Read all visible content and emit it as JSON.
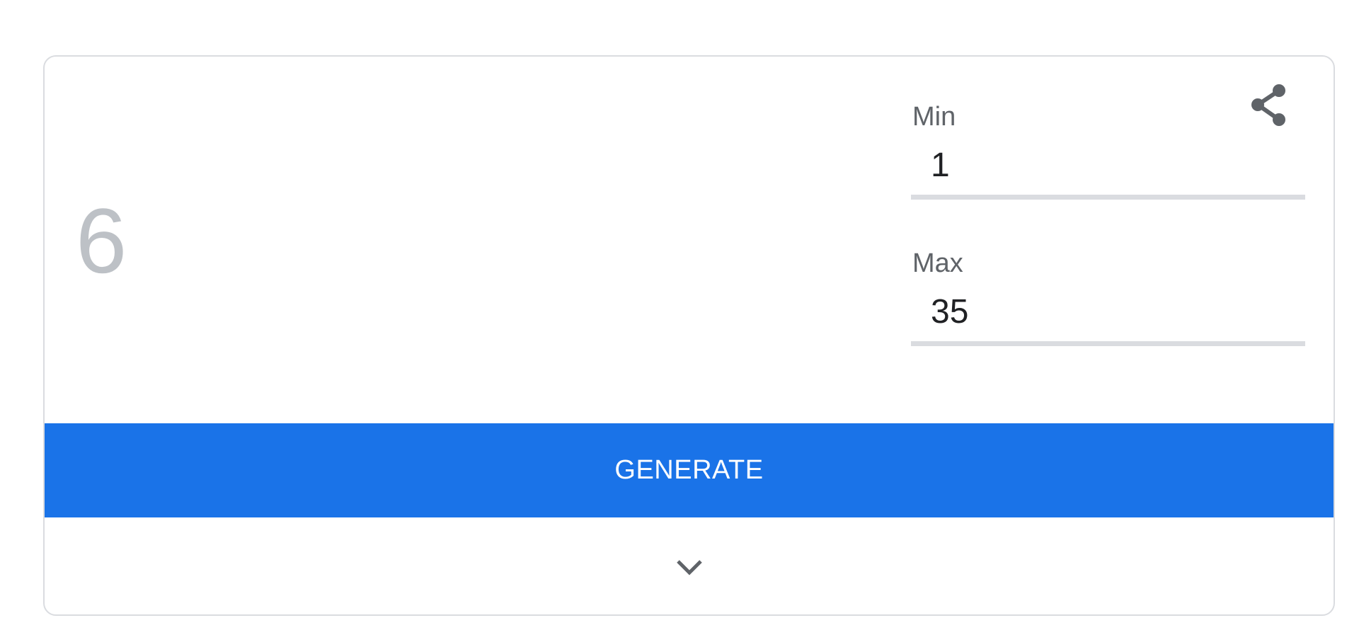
{
  "generator": {
    "result": "6",
    "min": {
      "label": "Min",
      "value": "1"
    },
    "max": {
      "label": "Max",
      "value": "35"
    },
    "generate_label": "GENERATE"
  },
  "icons": {
    "share": "share-icon",
    "expand": "chevron-down-icon"
  },
  "colors": {
    "accent": "#1a73e8",
    "result_text": "#bdc1c6",
    "label_text": "#5f6368",
    "input_text": "#202124",
    "divider": "#dadce0",
    "icon": "#5f6368"
  }
}
